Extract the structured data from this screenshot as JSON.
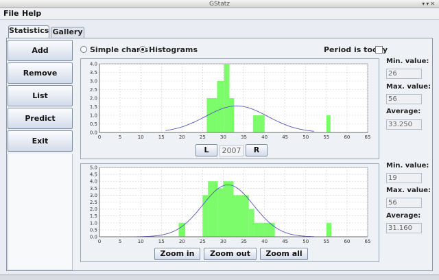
{
  "window": {
    "title": "GStatz"
  },
  "menu": {
    "file": "File",
    "help": "Help"
  },
  "tabs": [
    {
      "label": "Statistics",
      "active": true
    },
    {
      "label": "Gallery",
      "active": false
    }
  ],
  "sidebar": {
    "add": "Add",
    "remove": "Remove",
    "list": "List",
    "predict": "Predict",
    "exit": "Exit"
  },
  "options": {
    "simple_charts": "Simple charts",
    "histograms": "Histograms",
    "selected": "histograms",
    "period_today": "Period is today",
    "period_today_checked": false
  },
  "year_nav": {
    "left": "L",
    "year": "2007",
    "right": "R"
  },
  "zoom": {
    "zoom_in": "Zoom in",
    "zoom_out": "Zoom out",
    "zoom_all": "Zoom all"
  },
  "stats_top": {
    "min_label": "Min. value:",
    "min": "26",
    "max_label": "Max. value:",
    "max": "56",
    "avg_label": "Average:",
    "avg": "33.250"
  },
  "stats_bottom": {
    "min_label": "Min. value:",
    "min": "19",
    "max_label": "Max. value:",
    "max": "56",
    "avg_label": "Average:",
    "avg": "31.160"
  },
  "colors": {
    "bar": "#7cfc6b",
    "curve": "#5555bb",
    "grid": "#cfcfcf"
  },
  "chart_data": [
    {
      "type": "bar",
      "xlim": [
        0,
        65
      ],
      "ylim": [
        0,
        4.0
      ],
      "xticks": [
        0,
        5,
        10,
        15,
        20,
        25,
        30,
        35,
        40,
        45,
        50,
        55,
        60,
        65
      ],
      "yticks": [
        "0.0",
        "0.5",
        "1.0",
        "1.5",
        "2.0",
        "2.5",
        "3.0",
        "3.5",
        "4.0"
      ],
      "bars": [
        {
          "x0": 26,
          "x1": 28.5,
          "y": 2.0
        },
        {
          "x0": 28.5,
          "x1": 30.2,
          "y": 3.0
        },
        {
          "x0": 30.2,
          "x1": 31.5,
          "y": 4.0
        },
        {
          "x0": 31.5,
          "x1": 32.6,
          "y": 2.0
        },
        {
          "x0": 37.2,
          "x1": 40.0,
          "y": 1.0
        },
        {
          "x0": 55.0,
          "x1": 56.0,
          "y": 1.0
        }
      ],
      "curve": {
        "mean": 33.25,
        "sd": 7.5,
        "peak": 1.55,
        "x_from": 16,
        "x_to": 52
      }
    },
    {
      "type": "bar",
      "xlim": [
        0,
        65
      ],
      "ylim": [
        0,
        5.0
      ],
      "xticks": [
        0,
        5,
        10,
        15,
        20,
        25,
        30,
        35,
        40,
        45,
        50,
        55,
        60,
        65
      ],
      "yticks": [
        "0.0",
        "0.5",
        "1.0",
        "1.5",
        "2.0",
        "2.5",
        "3.0",
        "3.5",
        "4.0",
        "4.5",
        "5.0"
      ],
      "bars": [
        {
          "x0": 19.2,
          "x1": 20.8,
          "y": 1.0
        },
        {
          "x0": 25.0,
          "x1": 26.3,
          "y": 3.0
        },
        {
          "x0": 26.3,
          "x1": 28.7,
          "y": 4.0
        },
        {
          "x0": 28.7,
          "x1": 30.0,
          "y": 3.5
        },
        {
          "x0": 30.0,
          "x1": 32.5,
          "y": 4.0
        },
        {
          "x0": 32.5,
          "x1": 36.2,
          "y": 3.0
        },
        {
          "x0": 36.2,
          "x1": 37.5,
          "y": 2.0
        },
        {
          "x0": 37.5,
          "x1": 40.0,
          "y": 1.0
        },
        {
          "x0": 40.0,
          "x1": 42.5,
          "y": 1.0
        },
        {
          "x0": 55.0,
          "x1": 56.2,
          "y": 1.0
        }
      ],
      "curve": {
        "mean": 31.16,
        "sd": 6.2,
        "peak": 3.75,
        "x_from": 9,
        "x_to": 52
      }
    }
  ]
}
